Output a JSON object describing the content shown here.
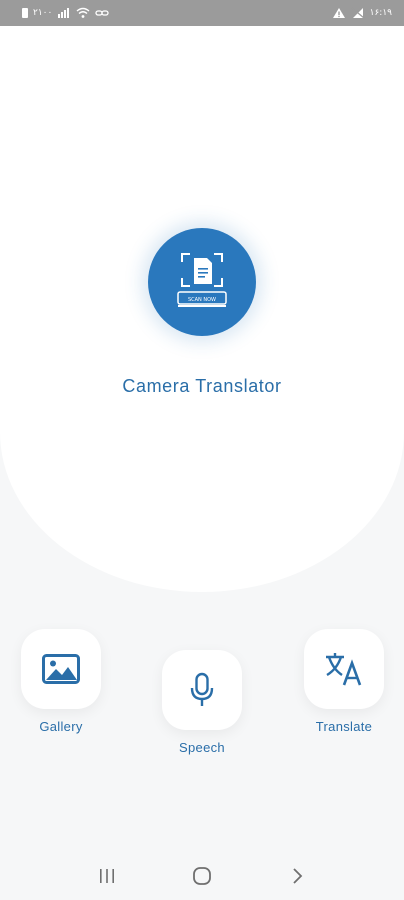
{
  "status_bar": {
    "left_text": "۲۱۰۰",
    "time": "۱۶:۱۹",
    "icons": [
      "battery-icon",
      "signal-icon",
      "wifi-icon",
      "link-icon",
      "warning-icon",
      "no-signal-icon"
    ]
  },
  "app": {
    "title": "Camera Translator",
    "logo_caption": "SCAN NOW",
    "accent_color": "#2a78bd"
  },
  "actions": {
    "gallery": {
      "label": "Gallery",
      "icon": "image-icon"
    },
    "speech": {
      "label": "Speech",
      "icon": "microphone-icon"
    },
    "translate": {
      "label": "Translate",
      "icon": "translate-icon"
    }
  },
  "nav": {
    "icons": [
      "recent-apps-icon",
      "home-icon",
      "back-icon"
    ]
  }
}
